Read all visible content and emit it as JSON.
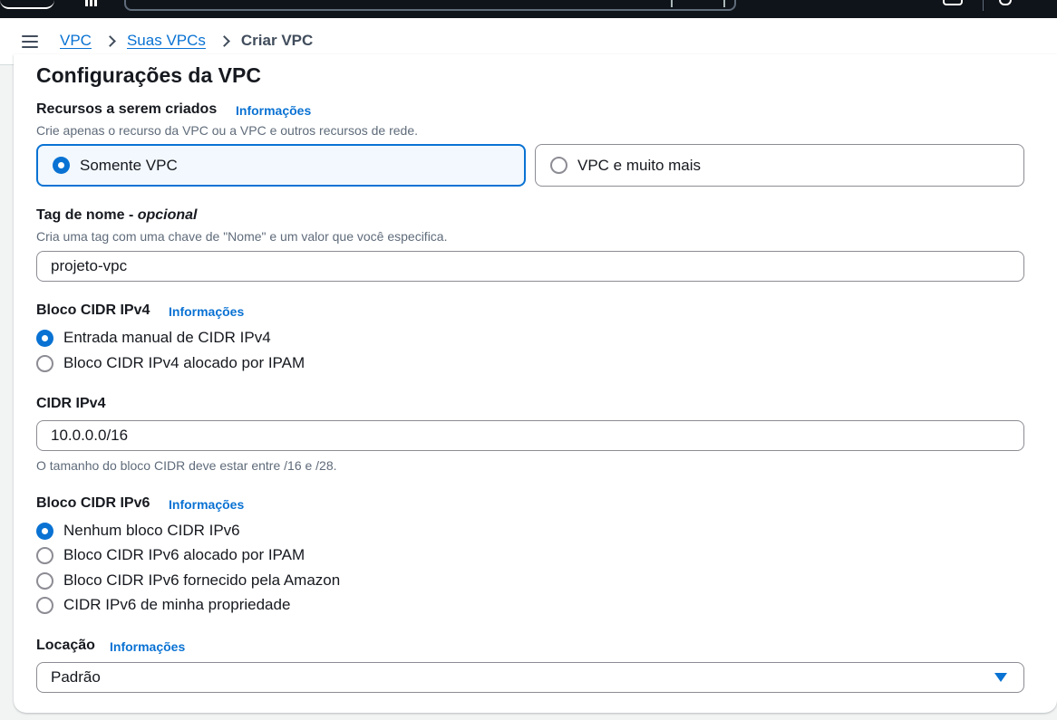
{
  "breadcrumb": {
    "items": [
      "VPC",
      "Suas VPCs"
    ],
    "current": "Criar VPC"
  },
  "section": {
    "title": "Configurações da VPC"
  },
  "resources": {
    "label": "Recursos a serem criados",
    "info": "Informações",
    "description": "Crie apenas o recurso da VPC ou a VPC e outros recursos de rede.",
    "options": [
      "Somente VPC",
      "VPC e muito mais"
    ],
    "selected": "Somente VPC"
  },
  "name_tag": {
    "label": "Tag de nome - ",
    "optional": "opcional",
    "description": "Cria uma tag com uma chave de \"Nome\" e um valor que você especifica.",
    "value": "projeto-vpc"
  },
  "ipv4_block": {
    "label": "Bloco CIDR IPv4",
    "info": "Informações",
    "options": [
      "Entrada manual de CIDR IPv4",
      "Bloco CIDR IPv4 alocado por IPAM"
    ],
    "selected": "Entrada manual de CIDR IPv4"
  },
  "ipv4_cidr": {
    "label": "CIDR IPv4",
    "value": "10.0.0.0/16",
    "hint": "O tamanho do bloco CIDR deve estar entre /16 e /28."
  },
  "ipv6_block": {
    "label": "Bloco CIDR IPv6",
    "info": "Informações",
    "options": [
      "Nenhum bloco CIDR IPv6",
      "Bloco CIDR IPv6 alocado por IPAM",
      "Bloco CIDR IPv6 fornecido pela Amazon",
      "CIDR IPv6 de minha propriedade"
    ],
    "selected": "Nenhum bloco CIDR IPv6"
  },
  "tenancy": {
    "label": "Locação",
    "info": "Informações",
    "value": "Padrão"
  },
  "colors": {
    "accent": "#0972d3",
    "header_bg": "#0f141a"
  }
}
